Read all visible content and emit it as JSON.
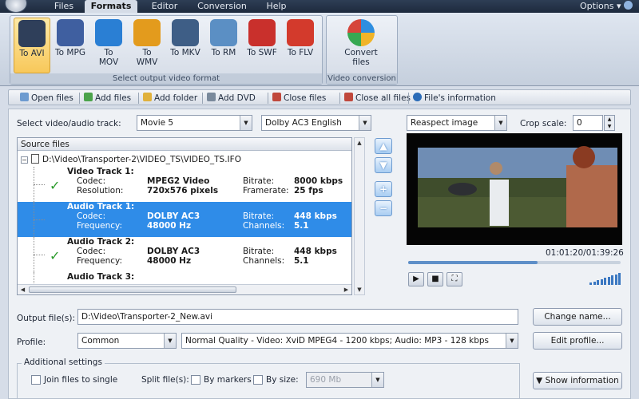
{
  "menu": {
    "tabs": [
      "Files",
      "Formats",
      "Editor",
      "Conversion",
      "Help"
    ],
    "active": "Formats",
    "options": "Options"
  },
  "ribbon": {
    "format_buttons": [
      {
        "label": "To AVI",
        "icon": "avi-film-icon",
        "color": "#2f3f5a",
        "active": true
      },
      {
        "label": "To MPG",
        "icon": "mpg-film-icon",
        "color": "#3f5fa0",
        "active": false
      },
      {
        "label": "To MOV",
        "icon": "quicktime-icon",
        "color": "#2a7fd4",
        "active": false
      },
      {
        "label": "To WMV",
        "icon": "wmv-media-icon",
        "color": "#e39b1d",
        "active": false
      },
      {
        "label": "To MKV",
        "icon": "mkv-icon",
        "color": "#3e5e86",
        "active": false
      },
      {
        "label": "To RM",
        "icon": "realmedia-icon",
        "color": "#5b8fc4",
        "active": false
      },
      {
        "label": "To SWF",
        "icon": "flash-swf-icon",
        "color": "#c9302c",
        "active": false
      },
      {
        "label": "To FLV",
        "icon": "flv-icon",
        "color": "#d33a2c",
        "active": false
      }
    ],
    "group1_label": "Select output video format",
    "convert": {
      "label": "Convert files",
      "icon": "convert-files-icon"
    },
    "group2_label": "Video conversion"
  },
  "toolbar": [
    {
      "label": "Open files",
      "icon": "open-files-icon"
    },
    {
      "label": "Add files",
      "icon": "add-files-icon"
    },
    {
      "label": "Add folder",
      "icon": "add-folder-icon"
    },
    {
      "label": "Add DVD",
      "icon": "add-dvd-icon"
    },
    {
      "label": "Close files",
      "icon": "close-files-icon"
    },
    {
      "label": "Close all files",
      "icon": "close-all-files-icon"
    },
    {
      "label": "File's information",
      "icon": "info-icon"
    }
  ],
  "track_select": {
    "label": "Select video/audio track:",
    "movie": "Movie 5",
    "audio": "Dolby AC3 English"
  },
  "source": {
    "header": "Source files",
    "root": "D:\\Video\\Transporter-2\\VIDEO_TS\\VIDEO_TS.IFO",
    "tracks": [
      {
        "name": "Video Track 1:",
        "k1": "Codec:",
        "v1": "MPEG2 Video",
        "k2": "Resolution:",
        "v2": "720x576 pixels",
        "k3": "Bitrate:",
        "v3": "8000 kbps",
        "k4": "Framerate:",
        "v4": "25 fps",
        "checked": true,
        "selected": false
      },
      {
        "name": "Audio Track 1:",
        "k1": "Codec:",
        "v1": "DOLBY AC3",
        "k2": "Frequency:",
        "v2": "48000 Hz",
        "k3": "Bitrate:",
        "v3": "448 kbps",
        "k4": "Channels:",
        "v4": "5.1",
        "checked": false,
        "selected": true
      },
      {
        "name": "Audio Track 2:",
        "k1": "Codec:",
        "v1": "DOLBY AC3",
        "k2": "Frequency:",
        "v2": "48000 Hz",
        "k3": "Bitrate:",
        "v3": "448 kbps",
        "k4": "Channels:",
        "v4": "5.1",
        "checked": true,
        "selected": false
      },
      {
        "name": "Audio Track 3:",
        "k1": "",
        "v1": "",
        "k2": "",
        "v2": "",
        "k3": "",
        "v3": "",
        "k4": "",
        "v4": "",
        "checked": false,
        "selected": false
      }
    ]
  },
  "preview": {
    "aspect": "Reaspect image",
    "crop_label": "Crop scale:",
    "crop_value": "0",
    "time": "01:01:20/01:39:26",
    "progress": 0.61
  },
  "output": {
    "label": "Output file(s):",
    "path": "D:\\Video\\Transporter-2_New.avi",
    "change_btn": "Change name...",
    "profile_label": "Profile:",
    "profile": "Common",
    "quality": "Normal Quality - Video: XviD MPEG4 - 1200 kbps; Audio: MP3 - 128 kbps",
    "edit_btn": "Edit profile..."
  },
  "additional": {
    "legend": "Additional settings",
    "join": "Join files to single",
    "split_label": "Split file(s):",
    "by_markers": "By markers",
    "by_size": "By size:",
    "size_value": "690 Mb",
    "show_info": "Show information"
  }
}
